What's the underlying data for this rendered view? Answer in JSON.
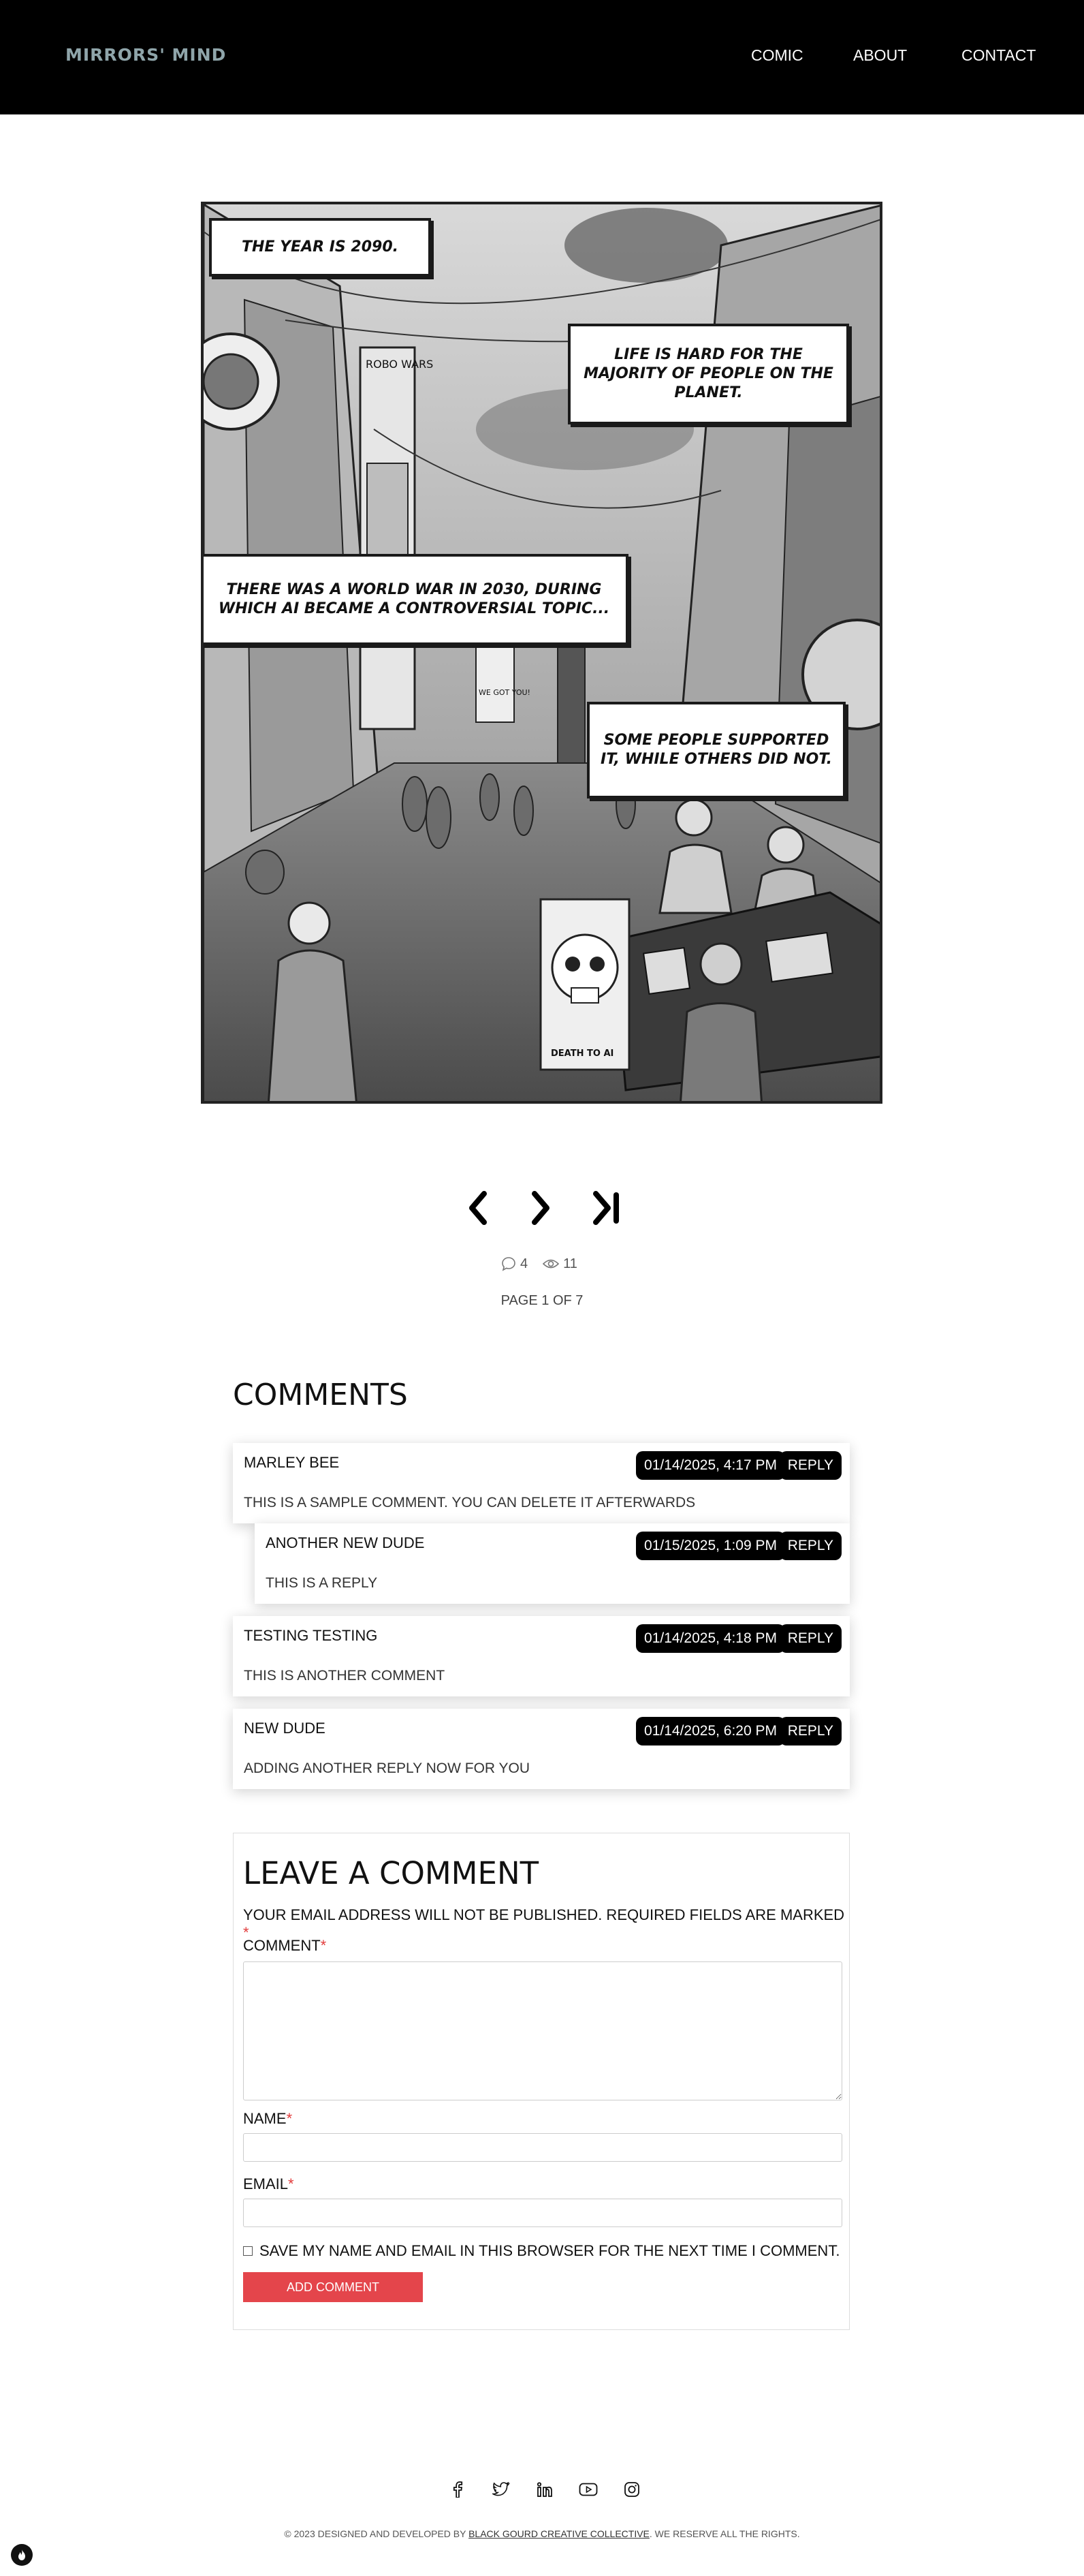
{
  "header": {
    "logo": "MIRRORS' MIND",
    "nav": {
      "comic": "COMIC",
      "about": "ABOUT",
      "contact": "CONTACT"
    }
  },
  "comic": {
    "captions": [
      "THE YEAR IS 2090.",
      "LIFE IS HARD FOR THE MAJORITY OF PEOPLE ON THE PLANET.",
      "THERE WAS A WORLD WAR IN 2030, DURING WHICH AI BECAME A CONTROVERSIAL TOPIC...",
      "SOME PEOPLE SUPPORTED IT, WHILE OTHERS DID NOT."
    ],
    "signs": {
      "robo": "Robo Wars",
      "banner": "We got you!",
      "death": "DEATH To AI"
    }
  },
  "stats": {
    "comments": "4",
    "views": "11"
  },
  "pagination": {
    "indicator": "PAGE 1 OF 7"
  },
  "comments": {
    "title": "COMMENTS",
    "reply_label": "REPLY",
    "items": [
      {
        "author": "MARLEY BEE",
        "date": "01/14/2025, 4:17 PM",
        "text": "THIS IS A SAMPLE COMMENT. YOU CAN DELETE IT AFTERWARDS"
      },
      {
        "author": "ANOTHER NEW DUDE",
        "date": "01/15/2025, 1:09 PM",
        "text": "THIS IS A REPLY"
      },
      {
        "author": "TESTING TESTING",
        "date": "01/14/2025, 4:18 PM",
        "text": "THIS IS ANOTHER COMMENT"
      },
      {
        "author": "NEW DUDE",
        "date": "01/14/2025, 6:20 PM",
        "text": "ADDING ANOTHER REPLY NOW FOR YOU"
      }
    ]
  },
  "form": {
    "title": "LEAVE A COMMENT",
    "note": "YOUR EMAIL ADDRESS WILL NOT BE PUBLISHED. REQUIRED FIELDS ARE MARKED",
    "required_mark": "*",
    "comment_label": "COMMENT",
    "name_label": "NAME",
    "email_label": "EMAIL",
    "save_label": "SAVE MY NAME AND EMAIL IN THIS BROWSER FOR THE NEXT TIME I COMMENT.",
    "submit_label": "ADD COMMENT"
  },
  "footer": {
    "copyright_prefix": "© 2023 DESIGNED AND DEVELOPED BY",
    "copyright_link": "BLACK GOURD CREATIVE COLLECTIVE",
    "copyright_suffix": ". WE RESERVE ALL THE RIGHTS.",
    "socials": [
      "facebook-icon",
      "twitter-icon",
      "linkedin-icon",
      "youtube-icon",
      "instagram-icon"
    ]
  },
  "colors": {
    "accent": "#e4454b",
    "header_bg": "#000000",
    "logo": "#8fa5aa"
  }
}
